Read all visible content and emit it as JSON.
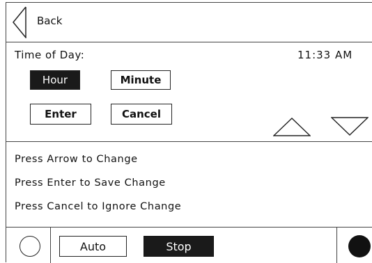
{
  "header": {
    "back_label": "Back"
  },
  "time_panel": {
    "label": "Time of Day:",
    "current_time": "11:33 AM",
    "buttons": {
      "hour": "Hour",
      "minute": "Minute",
      "enter": "Enter",
      "cancel": "Cancel"
    },
    "selected": "hour"
  },
  "instructions": [
    "Press Arrow to Change",
    "Press Enter to Save Change",
    "Press Cancel to Ignore Change"
  ],
  "footer": {
    "auto_label": "Auto",
    "stop_label": "Stop"
  },
  "colors": {
    "selected_background": "#1a1a1a",
    "selected_text": "#ffffff",
    "border": "#444444"
  },
  "icons": {
    "back": "back-arrow-icon",
    "up": "up-arrow-icon",
    "down": "down-arrow-icon",
    "left_indicator": "empty-circle-icon",
    "right_indicator": "filled-circle-icon"
  }
}
